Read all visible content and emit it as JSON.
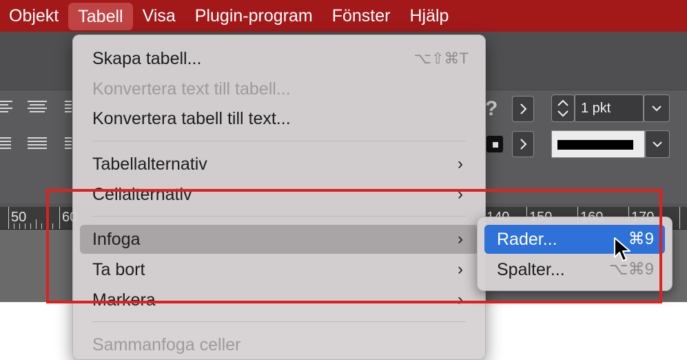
{
  "menubar": {
    "items": [
      {
        "label": "Objekt"
      },
      {
        "label": "Tabell"
      },
      {
        "label": "Visa"
      },
      {
        "label": "Plugin-program"
      },
      {
        "label": "Fönster"
      },
      {
        "label": "Hjälp"
      }
    ],
    "active_index": 1,
    "background": "#a3191a"
  },
  "toolbar": {
    "help_glyph": "?",
    "stroke_weight": "1 pkt"
  },
  "ruler": {
    "labels": [
      "50",
      "60",
      "140",
      "150",
      "160",
      "170"
    ]
  },
  "menu": {
    "items": [
      {
        "label": "Skapa tabell...",
        "shortcut": "⌥⇧⌘T",
        "enabled": true
      },
      {
        "label": "Konvertera text till tabell...",
        "enabled": false
      },
      {
        "label": "Konvertera tabell till text...",
        "enabled": true
      },
      {
        "label": "Tabellalternativ",
        "submenu": true,
        "enabled": true
      },
      {
        "label": "Cellalternativ",
        "submenu": true,
        "enabled": true
      },
      {
        "label": "Infoga",
        "submenu": true,
        "enabled": true,
        "highlighted": true
      },
      {
        "label": "Ta bort",
        "submenu": true,
        "enabled": true
      },
      {
        "label": "Markera",
        "submenu": true,
        "enabled": true
      },
      {
        "label": "Sammanfoga celler",
        "enabled": false
      }
    ],
    "arrow_glyph": "›"
  },
  "submenu": {
    "items": [
      {
        "label": "Rader...",
        "shortcut": "⌘9",
        "selected": true
      },
      {
        "label": "Spalter...",
        "shortcut": "⌥⌘9",
        "selected": false
      }
    ]
  },
  "colors": {
    "menubar": "#a3191a",
    "selection": "#2e72d9",
    "annotation": "#e0201f"
  }
}
